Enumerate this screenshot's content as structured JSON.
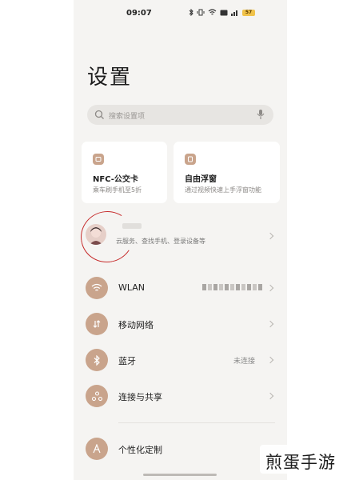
{
  "status_bar": {
    "time": "09:07",
    "icons": [
      "bluetooth-icon",
      "vibrate-icon",
      "wifi-icon",
      "hd-icon",
      "signal-icon"
    ],
    "battery": "57"
  },
  "page": {
    "title": "设置"
  },
  "search": {
    "placeholder": "搜索设置项"
  },
  "cards": [
    {
      "title": "NFC-公交卡",
      "subtitle": "乘车刷手机至5折",
      "icon": "nfc-card-icon"
    },
    {
      "title": "自由浮窗",
      "subtitle": "通过视频快速上手浮窗功能",
      "icon": "floating-window-icon"
    }
  ],
  "account": {
    "subtitle": "云服务、查找手机、登录设备等"
  },
  "settings": [
    {
      "label": "WLAN",
      "value": "",
      "icon": "wlan-icon"
    },
    {
      "label": "移动网络",
      "value": "",
      "icon": "mobile-network-icon"
    },
    {
      "label": "蓝牙",
      "value": "未连接",
      "icon": "bluetooth-icon"
    },
    {
      "label": "连接与共享",
      "value": "",
      "icon": "connection-sharing-icon"
    },
    {
      "label": "个性化定制",
      "value": "",
      "icon": "personalization-icon"
    }
  ],
  "watermark": "煎蛋手游",
  "colors": {
    "accent": "#c9a48c",
    "background": "#f5f4f2",
    "annotation": "#c62b2b"
  }
}
